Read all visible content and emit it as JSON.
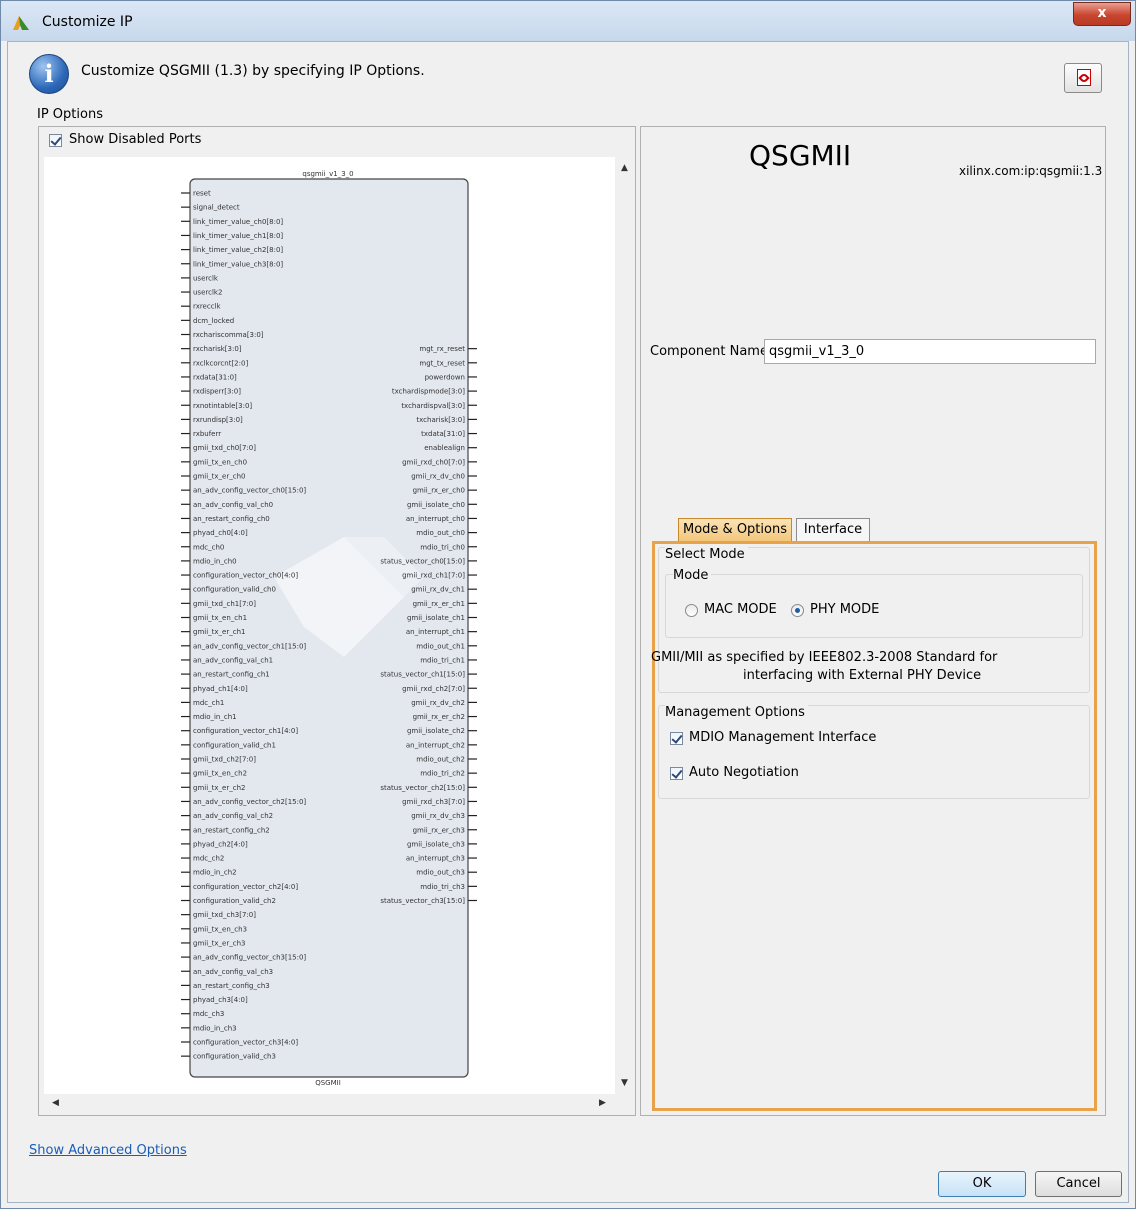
{
  "window": {
    "title": "Customize IP",
    "close_label": "x"
  },
  "header": {
    "description": "Customize QSGMII (1.3) by specifying IP Options."
  },
  "ip_options": {
    "label": "IP Options",
    "show_disabled_ports_label": "Show Disabled Ports",
    "show_disabled_ports_checked": true
  },
  "diagram": {
    "instance_name": "qsgmii_v1_3_0",
    "block_label": "QSGMII",
    "left_ports": [
      "reset",
      "signal_detect",
      "link_timer_value_ch0[8:0]",
      "link_timer_value_ch1[8:0]",
      "link_timer_value_ch2[8:0]",
      "link_timer_value_ch3[8:0]",
      "userclk",
      "userclk2",
      "rxrecclk",
      "dcm_locked",
      "rxchariscomma[3:0]",
      "rxcharisk[3:0]",
      "rxclkcorcnt[2:0]",
      "rxdata[31:0]",
      "rxdisperr[3:0]",
      "rxnotintable[3:0]",
      "rxrundisp[3:0]",
      "rxbuferr",
      "gmii_txd_ch0[7:0]",
      "gmii_tx_en_ch0",
      "gmii_tx_er_ch0",
      "an_adv_config_vector_ch0[15:0]",
      "an_adv_config_val_ch0",
      "an_restart_config_ch0",
      "phyad_ch0[4:0]",
      "mdc_ch0",
      "mdio_in_ch0",
      "configuration_vector_ch0[4:0]",
      "configuration_valid_ch0",
      "gmii_txd_ch1[7:0]",
      "gmii_tx_en_ch1",
      "gmii_tx_er_ch1",
      "an_adv_config_vector_ch1[15:0]",
      "an_adv_config_val_ch1",
      "an_restart_config_ch1",
      "phyad_ch1[4:0]",
      "mdc_ch1",
      "mdio_in_ch1",
      "configuration_vector_ch1[4:0]",
      "configuration_valid_ch1",
      "gmii_txd_ch2[7:0]",
      "gmii_tx_en_ch2",
      "gmii_tx_er_ch2",
      "an_adv_config_vector_ch2[15:0]",
      "an_adv_config_val_ch2",
      "an_restart_config_ch2",
      "phyad_ch2[4:0]",
      "mdc_ch2",
      "mdio_in_ch2",
      "configuration_vector_ch2[4:0]",
      "configuration_valid_ch2",
      "gmii_txd_ch3[7:0]",
      "gmii_tx_en_ch3",
      "gmii_tx_er_ch3",
      "an_adv_config_vector_ch3[15:0]",
      "an_adv_config_val_ch3",
      "an_restart_config_ch3",
      "phyad_ch3[4:0]",
      "mdc_ch3",
      "mdio_in_ch3",
      "configuration_vector_ch3[4:0]",
      "configuration_valid_ch3"
    ],
    "right_ports": [
      "mgt_rx_reset",
      "mgt_tx_reset",
      "powerdown",
      "txchardispmode[3:0]",
      "txchardispval[3:0]",
      "txcharisk[3:0]",
      "txdata[31:0]",
      "enablealign",
      "gmii_rxd_ch0[7:0]",
      "gmii_rx_dv_ch0",
      "gmii_rx_er_ch0",
      "gmii_isolate_ch0",
      "an_interrupt_ch0",
      "mdio_out_ch0",
      "mdio_tri_ch0",
      "status_vector_ch0[15:0]",
      "gmii_rxd_ch1[7:0]",
      "gmii_rx_dv_ch1",
      "gmii_rx_er_ch1",
      "gmii_isolate_ch1",
      "an_interrupt_ch1",
      "mdio_out_ch1",
      "mdio_tri_ch1",
      "status_vector_ch1[15:0]",
      "gmii_rxd_ch2[7:0]",
      "gmii_rx_dv_ch2",
      "gmii_rx_er_ch2",
      "gmii_isolate_ch2",
      "an_interrupt_ch2",
      "mdio_out_ch2",
      "mdio_tri_ch2",
      "status_vector_ch2[15:0]",
      "gmii_rxd_ch3[7:0]",
      "gmii_rx_dv_ch3",
      "gmii_rx_er_ch3",
      "gmii_isolate_ch3",
      "an_interrupt_ch3",
      "mdio_out_ch3",
      "mdio_tri_ch3",
      "status_vector_ch3[15:0]"
    ]
  },
  "ip_info": {
    "name": "QSGMII",
    "vlnv": "xilinx.com:ip:qsgmii:1.3"
  },
  "component": {
    "label": "Component Name",
    "value": "qsgmii_v1_3_0"
  },
  "tabs": [
    {
      "label": "Mode & Options",
      "active": true
    },
    {
      "label": "Interface",
      "active": false
    }
  ],
  "select_mode": {
    "group_label": "Select Mode",
    "mode_label": "Mode",
    "options": [
      {
        "label": "MAC MODE",
        "selected": false
      },
      {
        "label": "PHY MODE",
        "selected": true
      }
    ],
    "description_line1": "GMII/MII as specified by IEEE802.3-2008 Standard for",
    "description_line2": "interfacing with External PHY Device"
  },
  "management": {
    "group_label": "Management Options",
    "options": [
      {
        "label": "MDIO Management Interface",
        "checked": true
      },
      {
        "label": "Auto Negotiation",
        "checked": true
      }
    ]
  },
  "footer": {
    "advanced_link": "Show Advanced Options",
    "ok_label": "OK",
    "cancel_label": "Cancel"
  },
  "colors": {
    "tab_accent": "#e8a24a",
    "link": "#1a5db8",
    "block_fill": "#e3e8ef"
  }
}
